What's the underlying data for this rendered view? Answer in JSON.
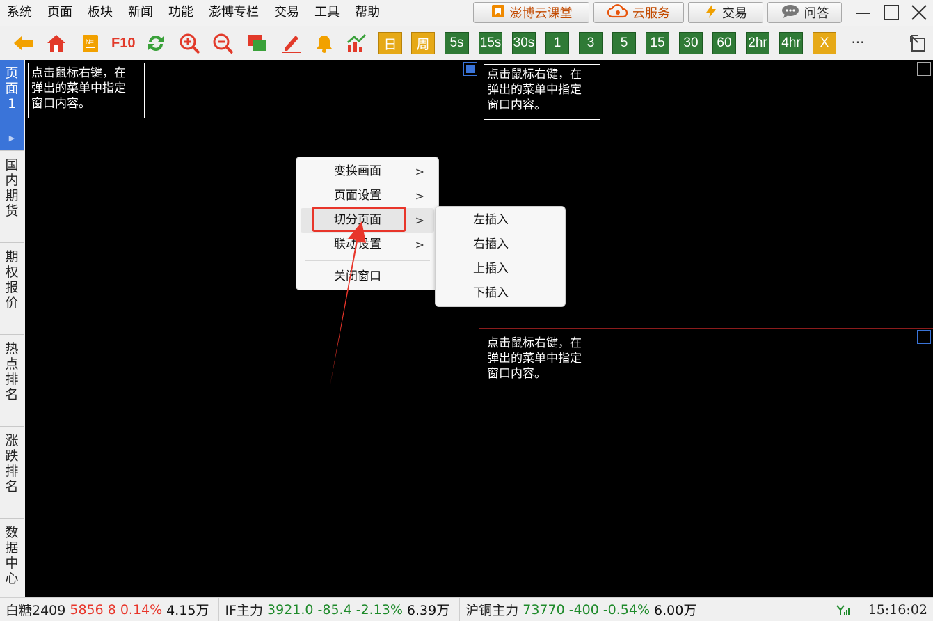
{
  "menubar": {
    "items": [
      "系统",
      "页面",
      "板块",
      "新闻",
      "功能",
      "澎博专栏",
      "交易",
      "工具",
      "帮助"
    ],
    "buttons": {
      "course": "澎博云课堂",
      "cloud": "云服务",
      "trade": "交易",
      "qa": "问答"
    }
  },
  "toolbar": {
    "f10": "F10",
    "day": "日",
    "week": "周",
    "periods": [
      "5s",
      "15s",
      "30s",
      "1",
      "3",
      "5",
      "15",
      "30",
      "60",
      "2hr",
      "4hr"
    ],
    "x_label": "X",
    "more": "···"
  },
  "left_tabs": [
    {
      "label": "页面1",
      "active": true
    },
    {
      "label": "国内期货",
      "active": false
    },
    {
      "label": "期权报价",
      "active": false
    },
    {
      "label": "热点排名",
      "active": false
    },
    {
      "label": "涨跌排名",
      "active": false
    },
    {
      "label": "数据中心",
      "active": false
    }
  ],
  "panels": {
    "hint": "点击鼠标右键，在\n弹出的菜单中指定\n窗口内容。"
  },
  "context_menu": {
    "items": [
      "变换画面",
      "页面设置",
      "切分页面",
      "联动设置",
      "关闭窗口"
    ],
    "submenu": [
      "左插入",
      "右插入",
      "上插入",
      "下插入"
    ]
  },
  "statusbar": {
    "quotes": [
      {
        "name": "白糖2409",
        "price": "5856",
        "change": "8",
        "pct": "0.14%",
        "vol": "4.15万",
        "color": "red"
      },
      {
        "name": "IF主力",
        "price": "3921.0",
        "change": "-85.4",
        "pct": "-2.13%",
        "vol": "6.39万",
        "color": "green"
      },
      {
        "name": "沪铜主力",
        "price": "73770",
        "change": "-400",
        "pct": "-0.54%",
        "vol": "6.00万",
        "color": "green"
      }
    ],
    "time": "15:16:02"
  },
  "colors": {
    "accent_blue": "#3a74d9",
    "up_red": "#e8352a",
    "down_green": "#1e8a2a",
    "highlight_red": "#e8352a"
  }
}
